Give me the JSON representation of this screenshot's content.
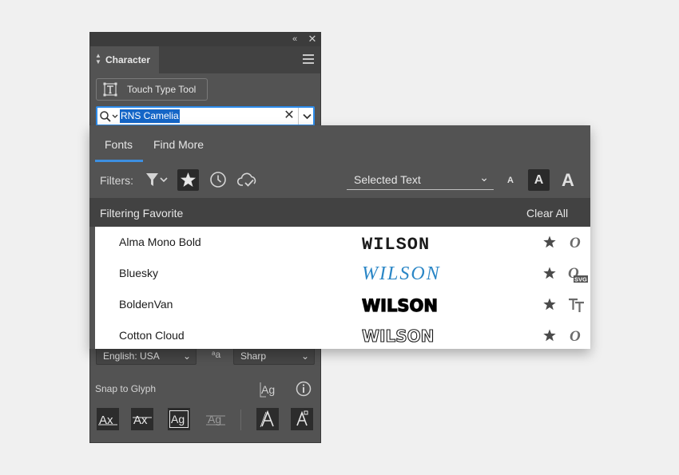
{
  "panel": {
    "title": "Character",
    "touch_type_tool_label": "Touch Type Tool",
    "search": {
      "value": "RNS Camelia"
    },
    "language": "English: USA",
    "antialias": "Sharp",
    "snap_to_glyph_label": "Snap to Glyph"
  },
  "fonts_panel": {
    "tabs": [
      {
        "label": "Fonts"
      },
      {
        "label": "Find More"
      }
    ],
    "filters_label": "Filters:",
    "preview_text_option": "Selected Text",
    "filter_status": "Filtering Favorite",
    "clear_all": "Clear All",
    "fonts": [
      {
        "name": "Alma Mono Bold",
        "sample": "WILSON",
        "favorite": true,
        "type": "opentype"
      },
      {
        "name": "Bluesky",
        "sample": "WILSON",
        "favorite": true,
        "type": "opentype-svg"
      },
      {
        "name": "BoldenVan",
        "sample": "WILSON",
        "favorite": true,
        "type": "truetype"
      },
      {
        "name": "Cotton Cloud",
        "sample": "WILSON",
        "favorite": true,
        "type": "opentype"
      }
    ],
    "preview_size_option_labels": [
      "A",
      "A",
      "A"
    ],
    "type_badge": "SVG"
  },
  "colors": {
    "panel_bg": "#535353",
    "accent_blue": "#2d8ceb",
    "selection_blue": "#1566c7",
    "bluesky_sample": "#2a86c6"
  }
}
